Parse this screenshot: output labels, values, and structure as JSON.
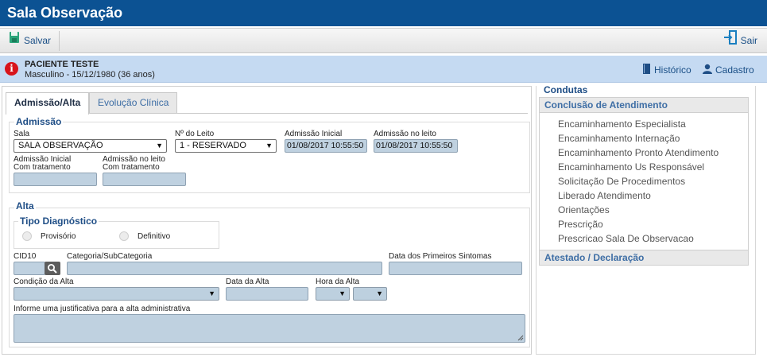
{
  "app": {
    "title": "Sala Observação"
  },
  "toolbar": {
    "save_label": "Salvar",
    "exit_label": "Sair"
  },
  "patient": {
    "name": "PACIENTE TESTE",
    "info": "Masculino - 15/12/1980 (36 anos)",
    "history_link": "Histórico",
    "register_link": "Cadastro"
  },
  "tabs": [
    {
      "label": "Admissão/Alta",
      "active": true
    },
    {
      "label": "Evolução Clínica",
      "active": false
    }
  ],
  "admissao": {
    "title": "Admissão",
    "sala_label": "Sala",
    "sala_value": "SALA OBSERVAÇÃO",
    "leito_label": "Nº do Leito",
    "leito_value": "1 - RESERVADO",
    "adm_inicial_label": "Admissão Inicial",
    "adm_inicial_value": "01/08/2017 10:55:50",
    "adm_leito_label": "Admissão no leito",
    "adm_leito_value": "01/08/2017 10:55:50",
    "adm_inicial_trat_label_1": "Admissão Inicial",
    "adm_inicial_trat_label_2": "Com tratamento",
    "adm_leito_trat_label_1": "Admissão no leito",
    "adm_leito_trat_label_2": "Com tratamento"
  },
  "alta": {
    "title": "Alta",
    "tipo_diag_title": "Tipo Diagnóstico",
    "radio_provisorio": "Provisório",
    "radio_definitivo": "Definitivo",
    "cid_label": "CID10",
    "categoria_label": "Categoria/SubCategoria",
    "data_sintomas_label": "Data dos Primeiros Sintomas",
    "condicao_label": "Condição da Alta",
    "data_alta_label": "Data da Alta",
    "hora_alta_label": "Hora da Alta",
    "justificativa_label": "Informe uma justificativa para a alta administrativa"
  },
  "condutas": {
    "title": "Condutas",
    "section1": "Conclusão de Atendimento",
    "items": [
      "Encaminhamento Especialista",
      "Encaminhamento Internação",
      "Encaminhamento Pronto Atendimento",
      "Encaminhamento Us Responsável",
      "Solicitação De Procedimentos",
      "Liberado Atendimento",
      "Orientações",
      "Prescrição",
      "Prescricao Sala De Observacao"
    ],
    "section2": "Atestado / Declaração"
  },
  "colors": {
    "header_blue": "#0c5293",
    "patient_bar": "#c5daf2",
    "alert_red": "#d8141b",
    "input_fill": "#bfd1e0"
  }
}
